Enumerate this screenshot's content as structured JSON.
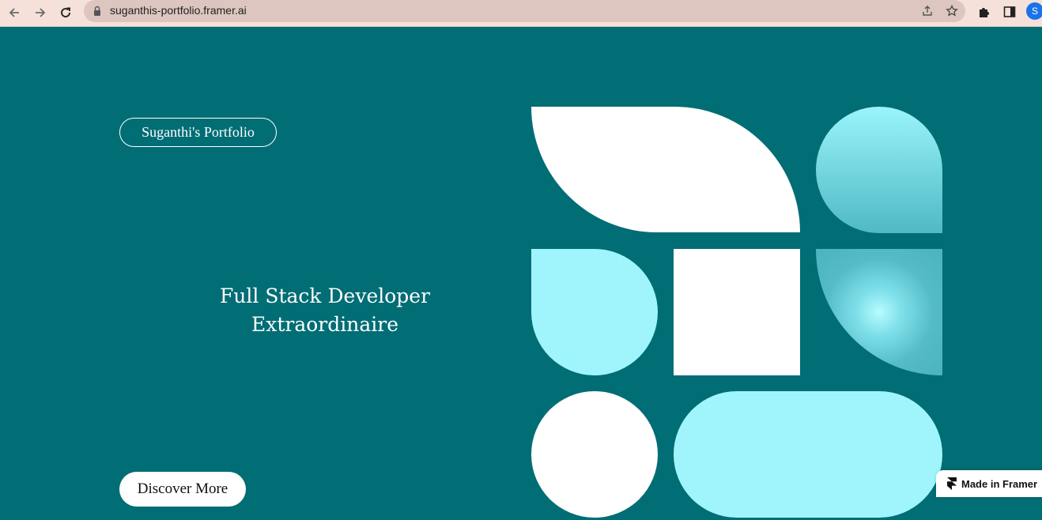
{
  "browser": {
    "url": "suganthis-portfolio.framer.ai",
    "profile_initial": "S",
    "icons": {
      "back": "arrow-left-icon",
      "forward": "arrow-right-icon",
      "reload": "reload-icon",
      "lock": "lock-icon",
      "share": "share-icon",
      "bookmark": "star-icon",
      "extensions": "puzzle-icon",
      "sidepanel": "side-panel-icon"
    }
  },
  "page": {
    "brand_pill": "Suganthi's Portfolio",
    "headline_line1": "Full Stack Developer",
    "headline_line2": "Extraordinaire",
    "cta": "Discover More",
    "framer_badge": "Made in Framer"
  },
  "colors": {
    "background": "#016d75",
    "accent_cyan": "#a0f5fc",
    "white": "#ffffff"
  }
}
